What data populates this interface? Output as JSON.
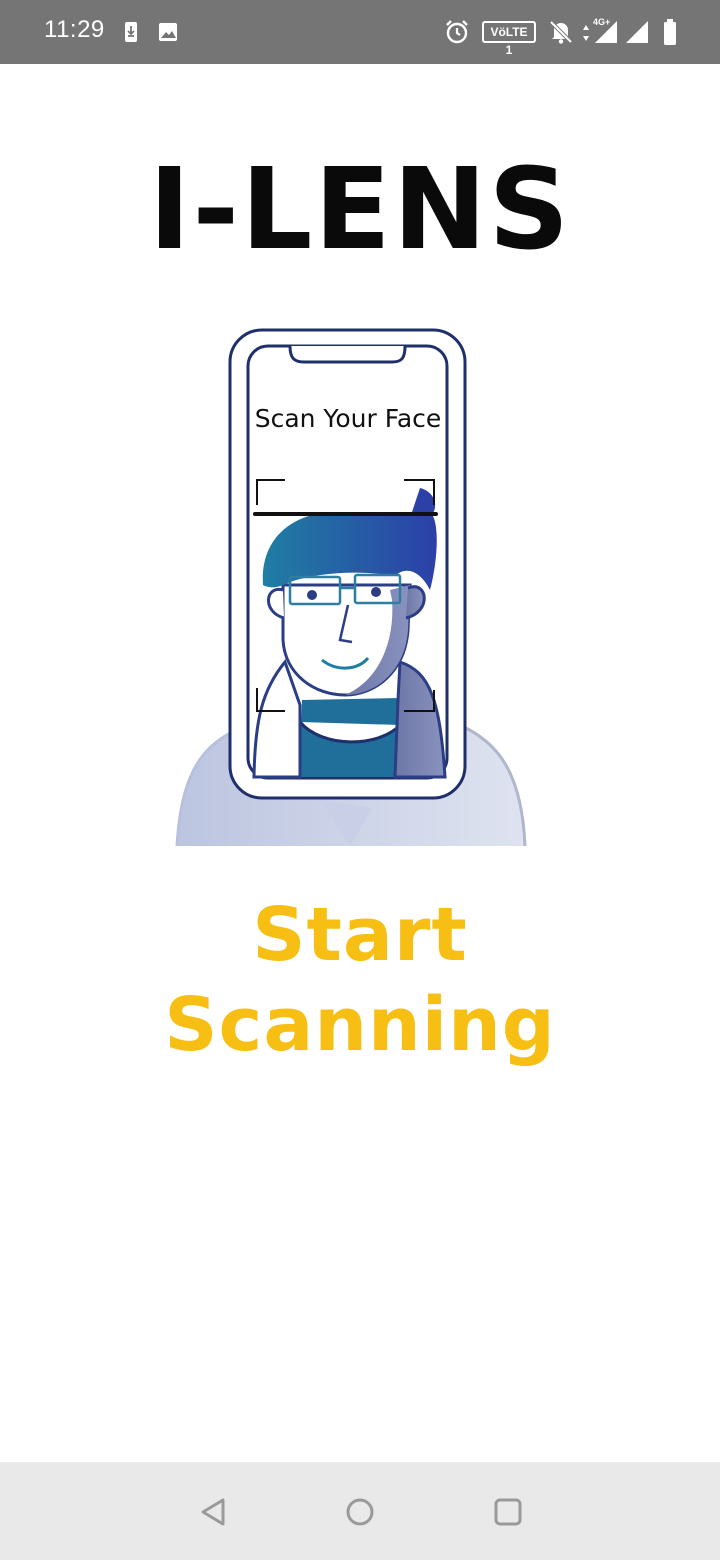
{
  "status_bar": {
    "time": "11:29",
    "volte": "VöLTE 1",
    "network": "4G+",
    "icons": [
      "download-notification-icon",
      "image-notification-icon",
      "alarm-icon",
      "volte-icon",
      "bell-muted-icon",
      "signal-4g-icon",
      "signal-icon",
      "battery-icon"
    ]
  },
  "app": {
    "title": "I-LENS",
    "illustration_caption": "Scan Your Face",
    "start_label": "Start Scanning"
  },
  "colors": {
    "accent": "#f7bf14",
    "phone_outline": "#1f2f6b",
    "hair": "#1d5fa0",
    "status_bar": "#757575"
  },
  "nav_bar": {
    "buttons": [
      "back-icon",
      "home-icon",
      "recents-icon"
    ]
  }
}
